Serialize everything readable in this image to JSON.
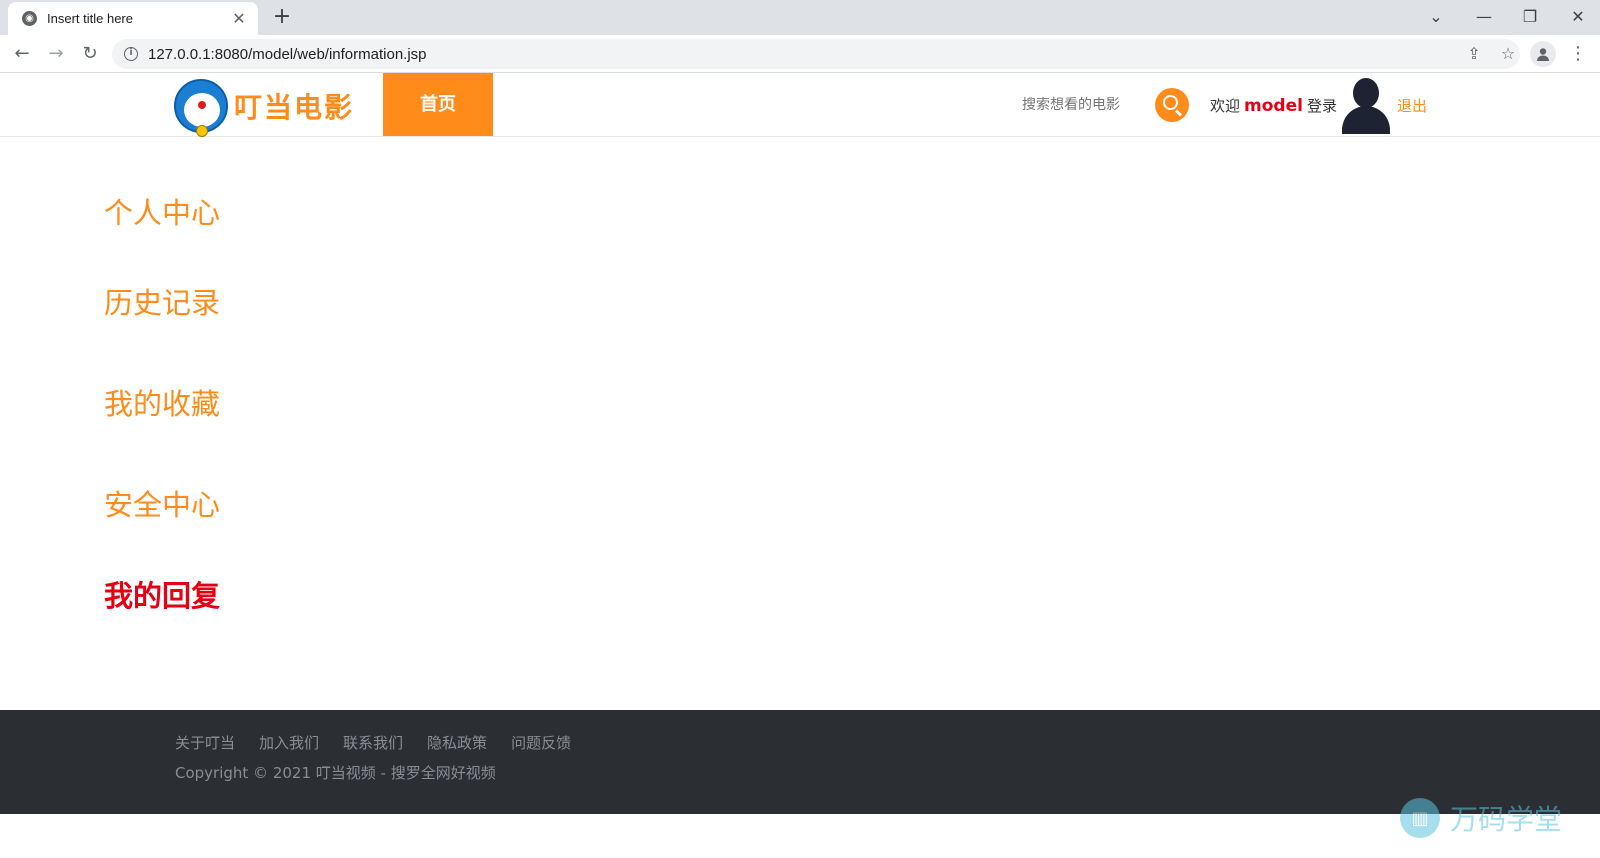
{
  "browser": {
    "tab_title": "Insert title here",
    "tab_close": "✕",
    "new_tab": "+",
    "url": "127.0.0.1:8080/model/web/information.jsp",
    "controls": {
      "dropdown": "⌄",
      "minimize": "—",
      "restore": "❐",
      "close": "✕"
    }
  },
  "header": {
    "brand": "叮当电影",
    "nav_home": "首页",
    "search_placeholder": "搜索想看的电影",
    "welcome_prefix": "欢迎",
    "username": "model",
    "login": "登录",
    "logout": "退出"
  },
  "side_menu": {
    "items": [
      {
        "label": "个人中心"
      },
      {
        "label": "历史记录"
      },
      {
        "label": "我的收藏"
      },
      {
        "label": "安全中心"
      },
      {
        "label": "我的回复"
      }
    ],
    "active_label": "我的回复"
  },
  "footer": {
    "links": [
      {
        "label": "关于叮当"
      },
      {
        "label": "加入我们"
      },
      {
        "label": "联系我们"
      },
      {
        "label": "隐私政策"
      },
      {
        "label": "问题反馈"
      }
    ],
    "copyright": "Copyright © 2021 叮当视频 - 搜罗全网好视频"
  },
  "watermark": {
    "text": "万码学堂"
  },
  "colors": {
    "accent": "#ff8c1a",
    "active": "#e60012",
    "footer_bg": "#2b2e33"
  }
}
